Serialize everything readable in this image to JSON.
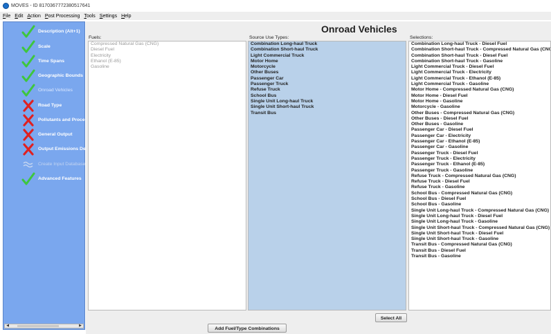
{
  "window": {
    "title": "MOVES - ID 8170367772380517641"
  },
  "menu": [
    {
      "u": "F",
      "rest": "ile"
    },
    {
      "u": "E",
      "rest": "dit"
    },
    {
      "u": "A",
      "rest": "ction"
    },
    {
      "u": "P",
      "rest": "ost Processing"
    },
    {
      "u": "T",
      "rest": "ools"
    },
    {
      "u": "S",
      "rest": "ettings"
    },
    {
      "u": "H",
      "rest": "elp"
    }
  ],
  "sidebar": {
    "items": [
      {
        "label": "Description (Alt+1)",
        "icon": "check-icon"
      },
      {
        "label": "Scale",
        "icon": "check-icon"
      },
      {
        "label": "Time Spans",
        "icon": "check-icon"
      },
      {
        "label": "Geographic Bounds",
        "icon": "check-icon"
      },
      {
        "label": "Onroad Vehicles",
        "icon": "check-icon"
      },
      {
        "label": "Road Type",
        "icon": "x-icon"
      },
      {
        "label": "Pollutants and Processes",
        "icon": "x-icon"
      },
      {
        "label": "General Output",
        "icon": "x-icon"
      },
      {
        "label": "Output Emissions Detail",
        "icon": "x-icon"
      },
      {
        "label": "Create Input Database",
        "icon": "wave-icon"
      },
      {
        "label": "Advanced Features",
        "icon": "check-icon"
      }
    ]
  },
  "main": {
    "title": "Onroad Vehicles",
    "fuels_label": "Fuels:",
    "sources_label": "Source Use Types:",
    "selections_label": "Selections:",
    "fuels": [
      "Compressed Natural Gas (CNG)",
      "Diesel Fuel",
      "Electricity",
      "Ethanol (E-85)",
      "Gasoline"
    ],
    "sources": [
      "Combination Long-haul Truck",
      "Combination Short-haul Truck",
      "Light Commercial Truck",
      "Motor Home",
      "Motorcycle",
      "Other Buses",
      "Passenger Car",
      "Passenger Truck",
      "Refuse Truck",
      "School Bus",
      "Single Unit Long-haul Truck",
      "Single Unit Short-haul Truck",
      "Transit Bus"
    ],
    "selections": [
      "Combination Long-haul Truck - Diesel Fuel",
      "Combination Short-haul Truck - Compressed Natural Gas (CNG)",
      "Combination Short-haul Truck - Diesel Fuel",
      "Combination Short-haul Truck - Gasoline",
      "Light Commercial Truck - Diesel Fuel",
      "Light Commercial Truck - Electricity",
      "Light Commercial Truck - Ethanol (E-85)",
      "Light Commercial Truck - Gasoline",
      "Motor Home - Compressed Natural Gas (CNG)",
      "Motor Home - Diesel Fuel",
      "Motor Home - Gasoline",
      "Motorcycle - Gasoline",
      "Other Buses - Compressed Natural Gas (CNG)",
      "Other Buses - Diesel Fuel",
      "Other Buses - Gasoline",
      "Passenger Car - Diesel Fuel",
      "Passenger Car - Electricity",
      "Passenger Car - Ethanol (E-85)",
      "Passenger Car - Gasoline",
      "Passenger Truck - Diesel Fuel",
      "Passenger Truck - Electricity",
      "Passenger Truck - Ethanol (E-85)",
      "Passenger Truck - Gasoline",
      "Refuse Truck - Compressed Natural Gas (CNG)",
      "Refuse Truck - Diesel Fuel",
      "Refuse Truck - Gasoline",
      "School Bus - Compressed Natural Gas (CNG)",
      "School Bus - Diesel Fuel",
      "School Bus - Gasoline",
      "Single Unit Long-haul Truck - Compressed Natural Gas (CNG)",
      "Single Unit Long-haul Truck - Diesel Fuel",
      "Single Unit Long-haul Truck - Gasoline",
      "Single Unit Short-haul Truck - Compressed Natural Gas (CNG)",
      "Single Unit Short-haul Truck - Diesel Fuel",
      "Single Unit Short-haul Truck - Gasoline",
      "Transit Bus - Compressed Natural Gas (CNG)",
      "Transit Bus - Diesel Fuel",
      "Transit Bus - Gasoline"
    ],
    "select_all_label": "Select All",
    "add_button_label": "Add Fuel/Type Combinations"
  },
  "colors": {
    "sidebar_bg": "#7aa7ee",
    "check": "#3ec63e",
    "x": "#e02020",
    "selection_bg": "#b9d1ea"
  }
}
